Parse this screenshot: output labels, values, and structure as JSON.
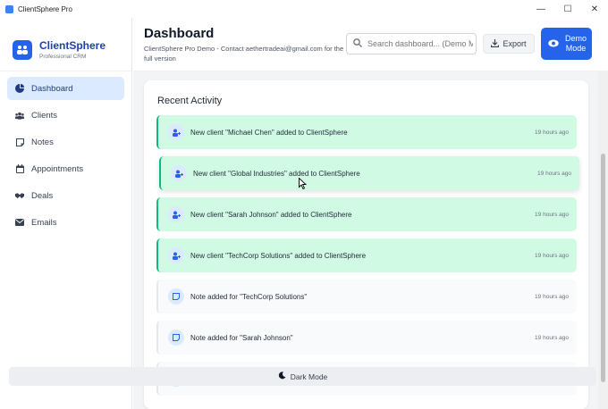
{
  "window": {
    "title": "ClientSphere Pro",
    "controls": [
      "—",
      "☐",
      "✕"
    ]
  },
  "brand": {
    "name": "ClientSphere",
    "subtitle": "Professional CRM"
  },
  "sidebar": {
    "items": [
      {
        "label": "Dashboard",
        "icon": "pie-chart-icon",
        "active": true
      },
      {
        "label": "Clients",
        "icon": "users-icon",
        "active": false
      },
      {
        "label": "Notes",
        "icon": "note-icon",
        "active": false
      },
      {
        "label": "Appointments",
        "icon": "calendar-icon",
        "active": false
      },
      {
        "label": "Deals",
        "icon": "handshake-icon",
        "active": false
      },
      {
        "label": "Emails",
        "icon": "envelope-icon",
        "active": false
      }
    ]
  },
  "header": {
    "title": "Dashboard",
    "subtitle": "ClientSphere Pro Demo - Contact aethertradeai@gmail.com for the full version",
    "search_placeholder": "Search dashboard... (Demo Mode)",
    "export_label": "Export",
    "demo_label": "Demo Mode"
  },
  "activity": {
    "title": "Recent Activity",
    "items": [
      {
        "text": "New client \"Michael Chen\" added to ClientSphere",
        "time": "19 hours ago",
        "kind": "client"
      },
      {
        "text": "New client \"Global Industries\" added to ClientSphere",
        "time": "19 hours ago",
        "kind": "client"
      },
      {
        "text": "New client \"Sarah Johnson\" added to ClientSphere",
        "time": "19 hours ago",
        "kind": "client"
      },
      {
        "text": "New client \"TechCorp Solutions\" added to ClientSphere",
        "time": "19 hours ago",
        "kind": "client"
      },
      {
        "text": "Note added for \"TechCorp Solutions\"",
        "time": "19 hours ago",
        "kind": "note"
      },
      {
        "text": "Note added for \"Sarah Johnson\"",
        "time": "19 hours ago",
        "kind": "note"
      }
    ]
  },
  "footer": {
    "dark_mode_label": "Dark Mode"
  },
  "colors": {
    "accent": "#2563eb",
    "client_bg": "#d1fae5",
    "client_border": "#10b981",
    "active_nav": "#dbeafe"
  }
}
